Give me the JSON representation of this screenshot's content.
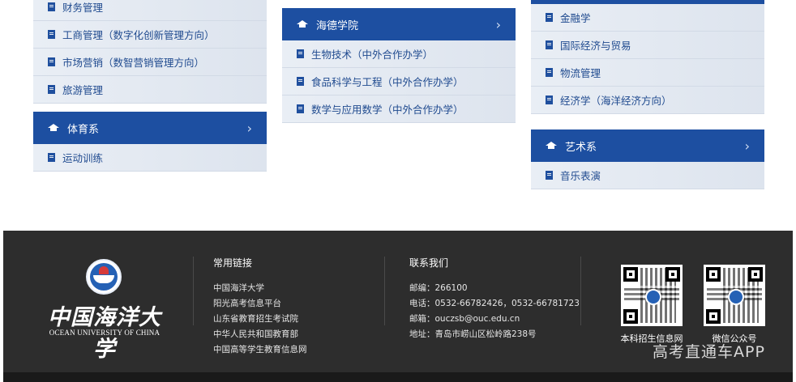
{
  "col1": {
    "items_top": [
      "财务管理",
      "工商管理（数字化创新管理方向）",
      "市场营销（数智营销管理方向）",
      "旅游管理"
    ],
    "section": {
      "title": "体育系",
      "items": [
        "运动训练"
      ]
    }
  },
  "col2": {
    "section": {
      "title": "海德学院",
      "items": [
        "生物技术（中外合作办学）",
        "食品科学与工程（中外合作办学）",
        "数学与应用数学（中外合作办学）"
      ]
    }
  },
  "col3": {
    "items_top": [
      "金融学",
      "国际经济与贸易",
      "物流管理",
      "经济学（海洋经济方向）"
    ],
    "section": {
      "title": "艺术系",
      "items": [
        "音乐表演"
      ]
    }
  },
  "footer": {
    "logo_cn": "中国海洋大学",
    "logo_en": "OCEAN UNIVERSITY OF CHINA",
    "links_title": "常用链接",
    "links": [
      "中国海洋大学",
      "阳光高考信息平台",
      "山东省教育招生考试院",
      "中华人民共和国教育部",
      "中国高等学生教育信息网"
    ],
    "contact_title": "联系我们",
    "contact": [
      "邮编：266100",
      "电话：0532-66782426，0532-66781723",
      "邮箱：ouczsb@ouc.edu.cn",
      "地址：青岛市崂山区松岭路238号"
    ],
    "qr1_caption": "本科招生信息网",
    "qr2_caption": "微信公众号"
  },
  "watermark": "高考直通车APP",
  "colors": {
    "header_blue": "#1d4fa1",
    "item_text": "#1f4a8f",
    "footer_bg": "#2d2d2d"
  }
}
